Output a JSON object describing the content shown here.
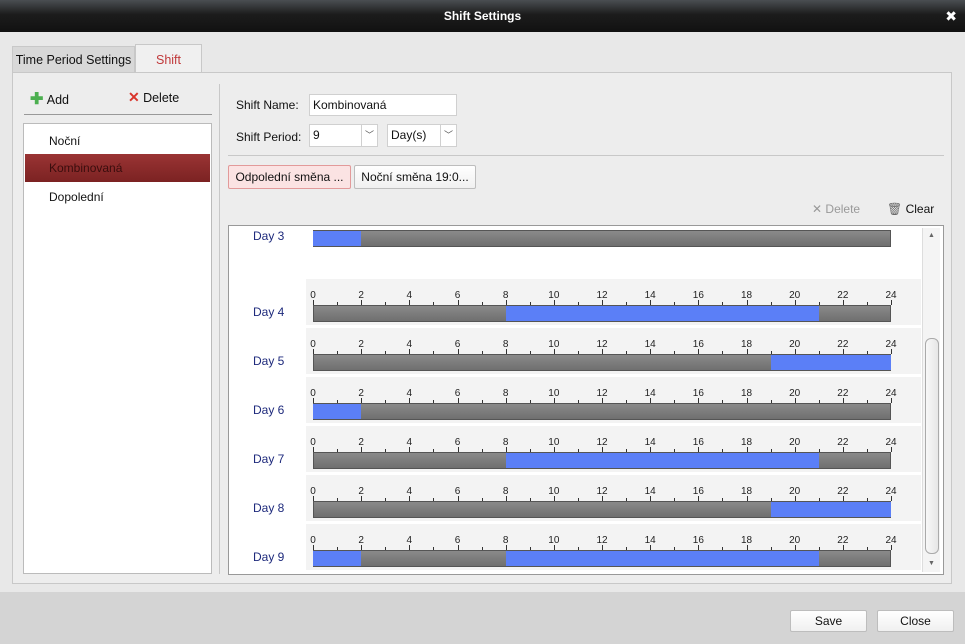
{
  "window": {
    "title": "Shift Settings",
    "close_icon": "close-icon"
  },
  "tabs": [
    {
      "label": "Time Period Settings"
    },
    {
      "label": "Shift",
      "active": true
    }
  ],
  "left": {
    "add_label": "Add",
    "delete_label": "Delete",
    "items": [
      {
        "label": "Noční"
      },
      {
        "label": "Kombinovaná",
        "selected": true
      },
      {
        "label": "Dopolední"
      }
    ]
  },
  "form": {
    "name_label": "Shift Name:",
    "name_value": "Kombinovaná",
    "period_label": "Shift Period:",
    "period_value": "9",
    "unit_value": "Day(s)"
  },
  "periods": [
    {
      "label": "Odpolední směna ...",
      "active": true
    },
    {
      "label": "Noční směna 19:0..."
    }
  ],
  "schedule": {
    "delete_label": "Delete",
    "clear_label": "Clear",
    "ticks": [
      "0",
      "2",
      "4",
      "6",
      "8",
      "10",
      "12",
      "14",
      "16",
      "18",
      "20",
      "22",
      "24"
    ],
    "days": [
      {
        "label": "Day 3",
        "partial": true,
        "segments": [
          [
            0,
            2
          ]
        ]
      },
      {
        "label": "Day 4",
        "segments": [
          [
            8,
            21
          ]
        ]
      },
      {
        "label": "Day 5",
        "segments": [
          [
            19,
            24
          ]
        ]
      },
      {
        "label": "Day 6",
        "segments": [
          [
            0,
            2
          ]
        ]
      },
      {
        "label": "Day 7",
        "segments": [
          [
            8,
            21
          ]
        ]
      },
      {
        "label": "Day 8",
        "segments": [
          [
            19,
            24
          ]
        ]
      },
      {
        "label": "Day 9",
        "segments": [
          [
            0,
            2
          ],
          [
            8,
            21
          ]
        ]
      }
    ]
  },
  "colors": {
    "selected": "#8b2a2a",
    "segment": "#5b7ff7",
    "accent": "#c0393b"
  },
  "footer": {
    "save_label": "Save",
    "close_label": "Close"
  }
}
